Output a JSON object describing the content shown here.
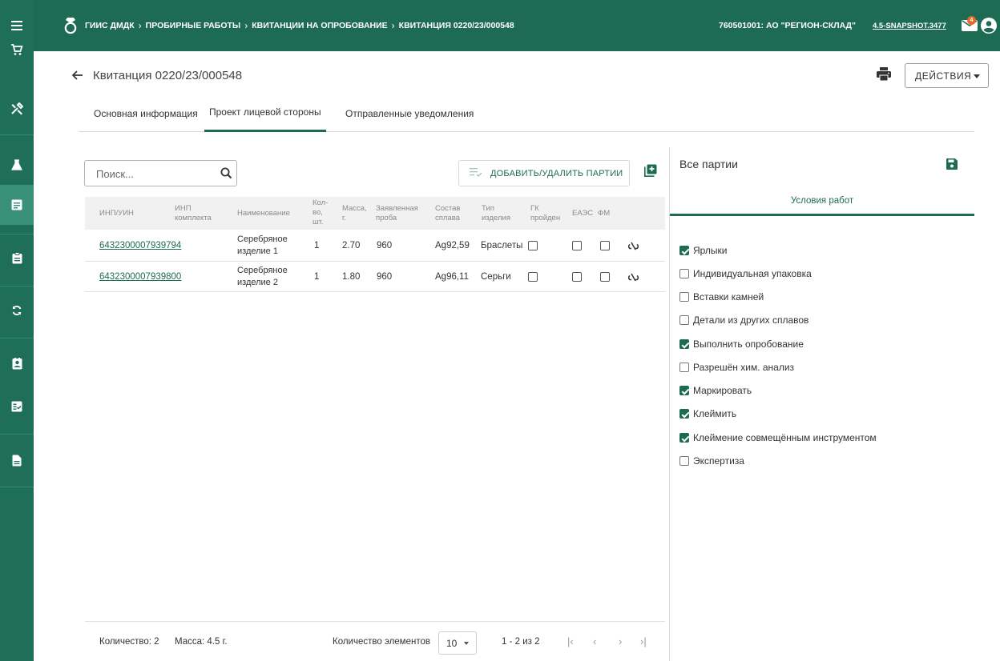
{
  "sidebar": {
    "items": [
      "menu-icon",
      "cart-icon",
      "tools-icon",
      "flask-icon",
      "document-list-icon",
      "clipboard-icon",
      "sync-icon",
      "contact-card-icon",
      "checklist-icon",
      "file-icon"
    ],
    "active": "document-list-icon"
  },
  "header": {
    "app": "ГИИС ДМДК",
    "crumb1": "ПРОБИРНЫЕ РАБОТЫ",
    "crumb2": "КВИТАНЦИИ НА ОПРОБОВАНИЕ",
    "crumb3": "КВИТАНЦИЯ 0220/23/000548",
    "org": "760501001: АО \"РЕГИОН-СКЛАД\"",
    "version": "4.5-SNAPSHOT.3477",
    "notifications": "4"
  },
  "page": {
    "title": "Квитанция 0220/23/000548",
    "actions_label": "Действия"
  },
  "tabs": [
    "Основная информация",
    "Проект лицевой стороны",
    "Отправленные уведомления"
  ],
  "toolbar": {
    "search_placeholder": "Поиск...",
    "add_remove_label": "ДОБАВИТЬ/УДАЛИТЬ ПАРТИИ"
  },
  "table": {
    "columns": {
      "inp": "ИНП/УИН",
      "kit1": "ИНП",
      "kit2": "комплекта",
      "name": "Наименование",
      "qty1": "Кол-",
      "qty2": "во,",
      "qty3": "шт.",
      "mass1": "Масса,",
      "mass2": "г.",
      "probe1": "Заявленная",
      "probe2": "проба",
      "alloy1": "Состав",
      "alloy2": "сплава",
      "type1": "Тип",
      "type2": "изделия",
      "gk1": "ГК",
      "gk2": "пройден",
      "eaes": "ЕАЭС",
      "fm": "ФМ"
    },
    "rows": [
      {
        "inp": "6432300007939794",
        "name1": "Серебряное",
        "name2": "изделие 1",
        "qty": "1",
        "mass": "2.70",
        "probe": "960",
        "alloy": "Ag92,59",
        "type": "Браслеты"
      },
      {
        "inp": "6432300007939800",
        "name1": "Серебряное",
        "name2": "изделие 2",
        "qty": "1",
        "mass": "1.80",
        "probe": "960",
        "alloy": "Ag96,11",
        "type": "Серьги"
      }
    ]
  },
  "footer": {
    "count": "Количество: 2",
    "mass": "Масса: 4.5 г.",
    "per_page_label": "Количество элементов",
    "per_page": "10",
    "range": "1 - 2 из 2"
  },
  "right_panel": {
    "title": "Все партии",
    "subtab": "Условия работ",
    "options": [
      {
        "label": "Ярлыки",
        "checked": true
      },
      {
        "label": "Индивидуальная упаковка",
        "checked": false
      },
      {
        "label": "Вставки камней",
        "checked": false
      },
      {
        "label": "Детали из других сплавов",
        "checked": false
      },
      {
        "label": "Выполнить опробование",
        "checked": true
      },
      {
        "label": "Разрешён хим. анализ",
        "checked": false
      },
      {
        "label": "Маркировать",
        "checked": true
      },
      {
        "label": "Клеймить",
        "checked": true
      },
      {
        "label": "Клеймение совмещённым инструментом",
        "checked": true
      },
      {
        "label": "Экспертиза",
        "checked": false
      }
    ]
  },
  "colors": {
    "brand": "#1e6b53",
    "sidebar": "#1f6e57",
    "badge": "#e8682b"
  }
}
